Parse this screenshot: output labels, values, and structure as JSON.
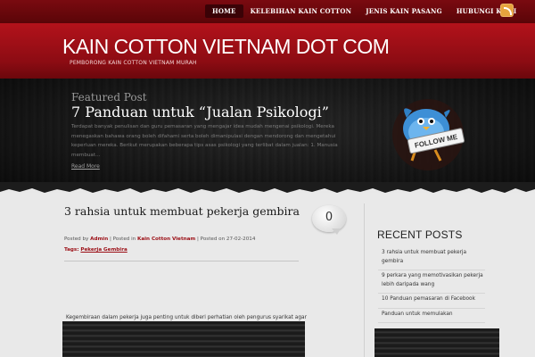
{
  "nav": {
    "items": [
      {
        "label": "HOME",
        "active": true
      },
      {
        "label": "KELEBIHAN KAIN COTTON",
        "active": false
      },
      {
        "label": "JENIS KAIN PASANG",
        "active": false
      },
      {
        "label": "HUBUNGI KAMI",
        "active": false
      }
    ],
    "rss_icon": "rss-icon"
  },
  "header": {
    "title": "KAIN COTTON VIETNAM DOT COM",
    "tagline": "PEMBORONG KAIN COTTON VIETNAM MURAH"
  },
  "featured": {
    "label": "Featured Post",
    "title": "7 Panduan untuk “Jualan Psikologi”",
    "excerpt": "Terdapat banyak penulisan dan guru pemasaran yang mengajar idea mudah mengenai psikologi. Mereka menegaskan bahawa orang boleh difahami serta boleh dimanipulasi dengan mendorong dan mengetahui keperluan mereka. Berikut merupakan beberapa tips asas psikologi yang terlibat dalam jualan: 1. Manusia membuat…",
    "read_more": "Read More",
    "follow_label": "FOLLOW ME"
  },
  "post": {
    "title": "3 rahsia untuk membuat pekerja gembira",
    "comment_count": "0",
    "meta_posted_by": "Posted by",
    "meta_author": "Admin",
    "meta_posted_in": "| Posted in",
    "meta_category": "Kain Cotton Vietnam",
    "meta_posted_on": "| Posted on 27-02-2014",
    "tags_label": "Tags:",
    "tag": "Pekerja Gembira",
    "body": "Kegembiraan dalam pekerja juga penting untuk diberi perhatian oleh pengurus syarikat agar"
  },
  "sidebar": {
    "recent_title": "RECENT POSTS",
    "recent": [
      "3 rahsia untuk membuat pekerja gembira",
      "9 perkara yang memotivasikan pekerja lebih daripada wang",
      "10 Panduan pemasaran di Facebook",
      "Panduan untuk memulakan"
    ]
  },
  "colors": {
    "brand_red": "#b3121b",
    "link_red": "#9b0d14",
    "dark_bg": "#1a1a1a"
  }
}
